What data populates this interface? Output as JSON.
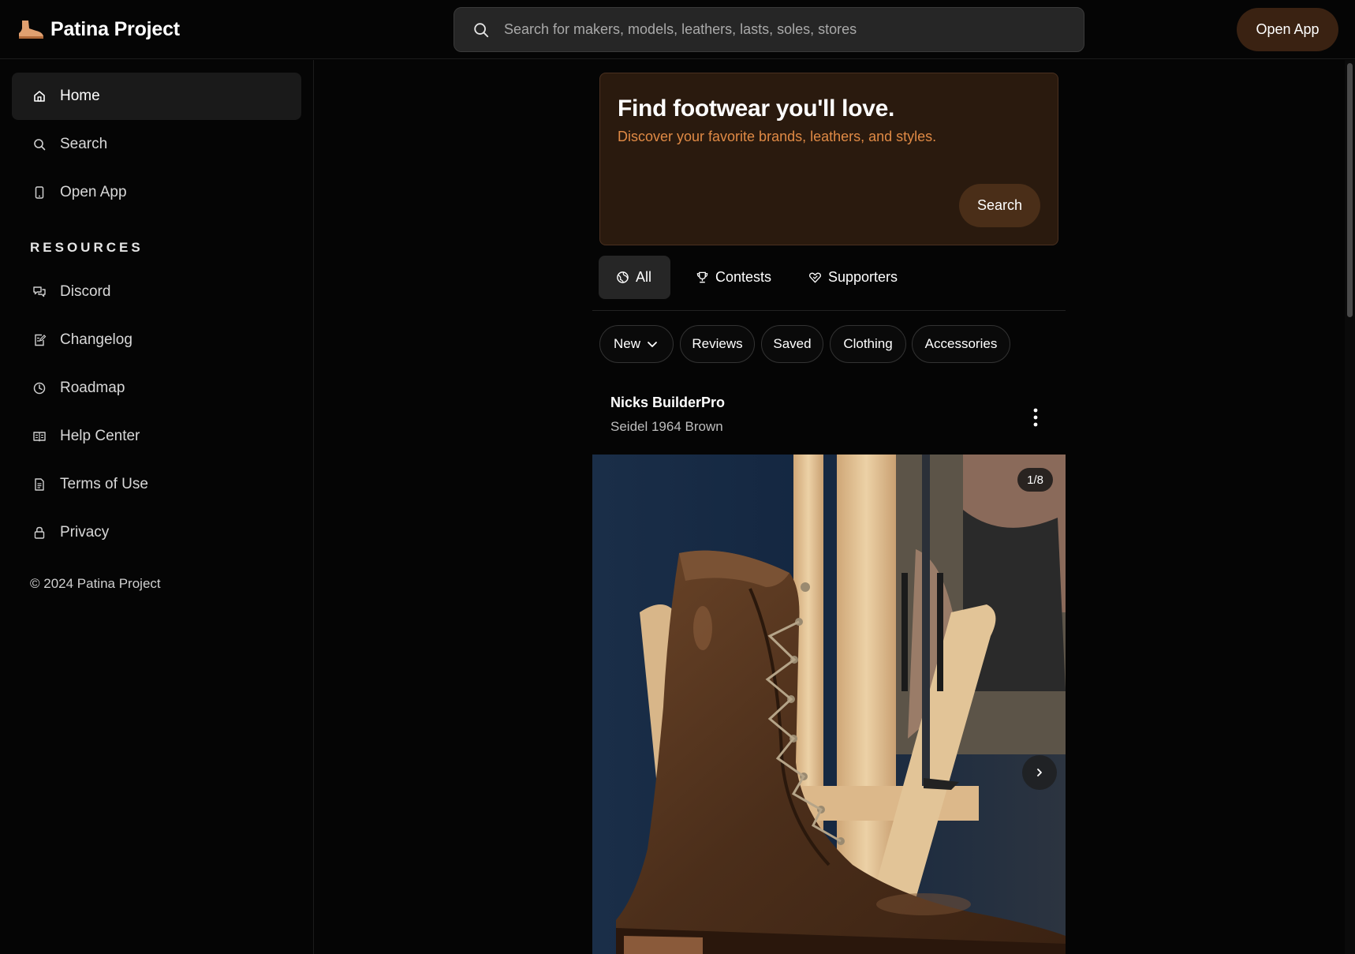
{
  "header": {
    "brand_name": "Patina Project",
    "logo_icon": "boot-logo-icon",
    "search_placeholder": "Search for makers, models, leathers, lasts, soles, stores",
    "open_app_label": "Open App"
  },
  "sidebar": {
    "nav": [
      {
        "label": "Home",
        "icon": "home-icon",
        "active": true
      },
      {
        "label": "Search",
        "icon": "search-icon"
      },
      {
        "label": "Open App",
        "icon": "phone-icon"
      }
    ],
    "resources_title": "RESOURCES",
    "resources": [
      {
        "label": "Discord",
        "icon": "chat-icon"
      },
      {
        "label": "Changelog",
        "icon": "edit-list-icon"
      },
      {
        "label": "Roadmap",
        "icon": "clock-icon"
      },
      {
        "label": "Help Center",
        "icon": "book-icon"
      },
      {
        "label": "Terms of Use",
        "icon": "document-icon"
      },
      {
        "label": "Privacy",
        "icon": "lock-icon"
      }
    ],
    "copyright": "© 2024 Patina Project"
  },
  "hero": {
    "title": "Find footwear you'll love.",
    "subtitle": "Discover your favorite brands, leathers, and styles.",
    "search_button": "Search"
  },
  "tabs": [
    {
      "label": "All",
      "icon": "globe-icon",
      "active": true
    },
    {
      "label": "Contests",
      "icon": "trophy-icon"
    },
    {
      "label": "Supporters",
      "icon": "heart-badge-icon"
    }
  ],
  "filters": {
    "sort_label": "New",
    "pills": [
      "Reviews",
      "Saved",
      "Clothing",
      "Accessories"
    ]
  },
  "post": {
    "author": "Nicks BuilderPro",
    "model": "Seidel 1964 Brown",
    "image_counter": "1/8"
  },
  "colors": {
    "background": "#050505",
    "hero_bg": "#2a1a0e",
    "accent_text": "#e08a45",
    "button_brown": "#3a2212"
  }
}
